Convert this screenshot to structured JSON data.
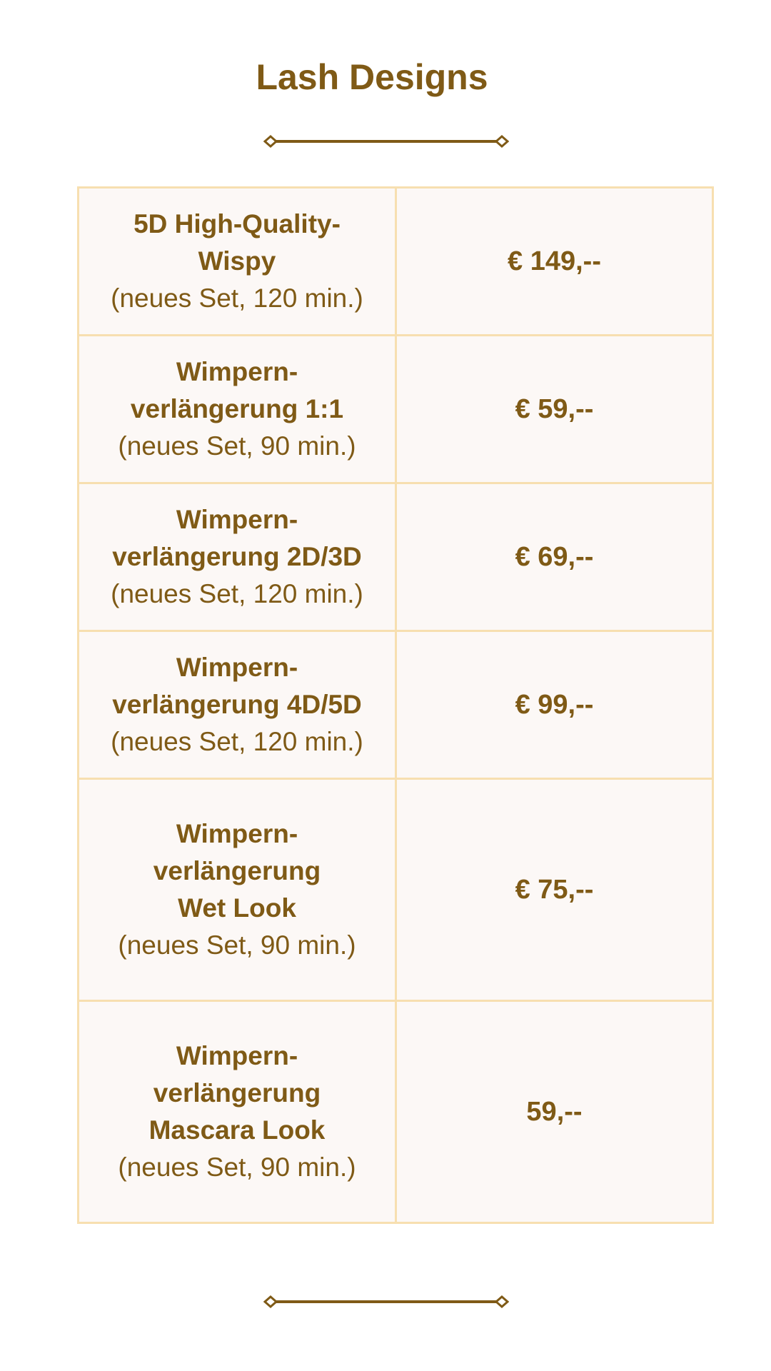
{
  "page": {
    "title": "Lash Designs"
  },
  "prices": {
    "rows": [
      {
        "name": "5D High-Quality-\nWispy",
        "detail": "(neues Set, 120 min.)",
        "price": "€ 149,--"
      },
      {
        "name": "Wimpern-\nverlängerung 1:1",
        "detail": "(neues Set, 90 min.)",
        "price": "€ 59,--"
      },
      {
        "name": "Wimpern-\nverlängerung 2D/3D",
        "detail": "(neues Set, 120 min.)",
        "price": "€ 69,--"
      },
      {
        "name": "Wimpern-\nverlängerung 4D/5D",
        "detail": "(neues Set, 120 min.)",
        "price": "€ 99,--"
      },
      {
        "name": "Wimpern-\nverlängerung\nWet Look",
        "detail": "(neues Set, 90 min.)",
        "price": "€ 75,--"
      },
      {
        "name": "Wimpern-\nverlängerung\nMascara Look",
        "detail": "(neues Set, 90 min.)",
        "price": "59,--"
      }
    ]
  },
  "colors": {
    "text": "#7f5a16",
    "border": "#f7dfb0",
    "cell_background": "#fcf8f6"
  },
  "icons": {
    "divider": "diamond-ended-line"
  }
}
